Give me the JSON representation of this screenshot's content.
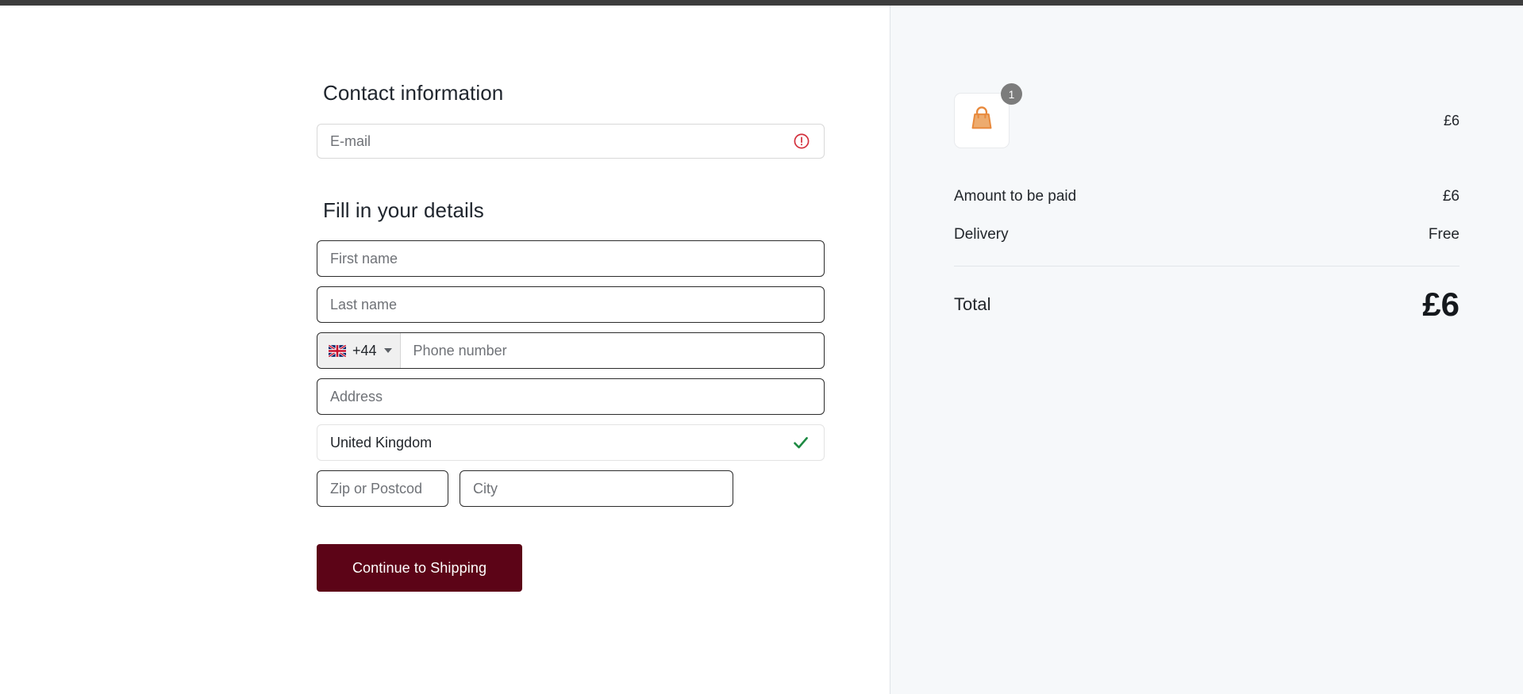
{
  "theme": {
    "topbar_color": "#3d3d3d",
    "accent_button_color": "#5c0417",
    "summary_bg_color": "#f6f8fa",
    "error_color": "#d32f3c",
    "success_color": "#1e8a43",
    "badge_color": "#7c7c7c",
    "bag_icon_color": "#e8893c"
  },
  "contact": {
    "heading": "Contact information",
    "email_placeholder": "E-mail",
    "email_value": "",
    "email_error_icon": "error-circle-icon"
  },
  "details": {
    "heading": "Fill in your details",
    "first_name_placeholder": "First name",
    "first_name_value": "",
    "last_name_placeholder": "Last name",
    "last_name_value": "",
    "phone": {
      "flag_icon": "uk-flag-icon",
      "dial_code": "+44",
      "caret_icon": "chevron-down-icon",
      "placeholder": "Phone number",
      "value": ""
    },
    "address_placeholder": "Address",
    "address_value": "",
    "country_value": "United Kingdom",
    "country_valid_icon": "check-icon",
    "zip_placeholder": "Zip or Postcod",
    "zip_value": "",
    "city_placeholder": "City",
    "city_value": "",
    "submit_label": "Continue to Shipping"
  },
  "summary": {
    "cart_item": {
      "icon": "shopping-bag-icon",
      "quantity": "1",
      "price": "£6"
    },
    "lines": [
      {
        "label": "Amount to be paid",
        "value": "£6"
      },
      {
        "label": "Delivery",
        "value": "Free"
      }
    ],
    "total_label": "Total",
    "total_value": "£6"
  }
}
